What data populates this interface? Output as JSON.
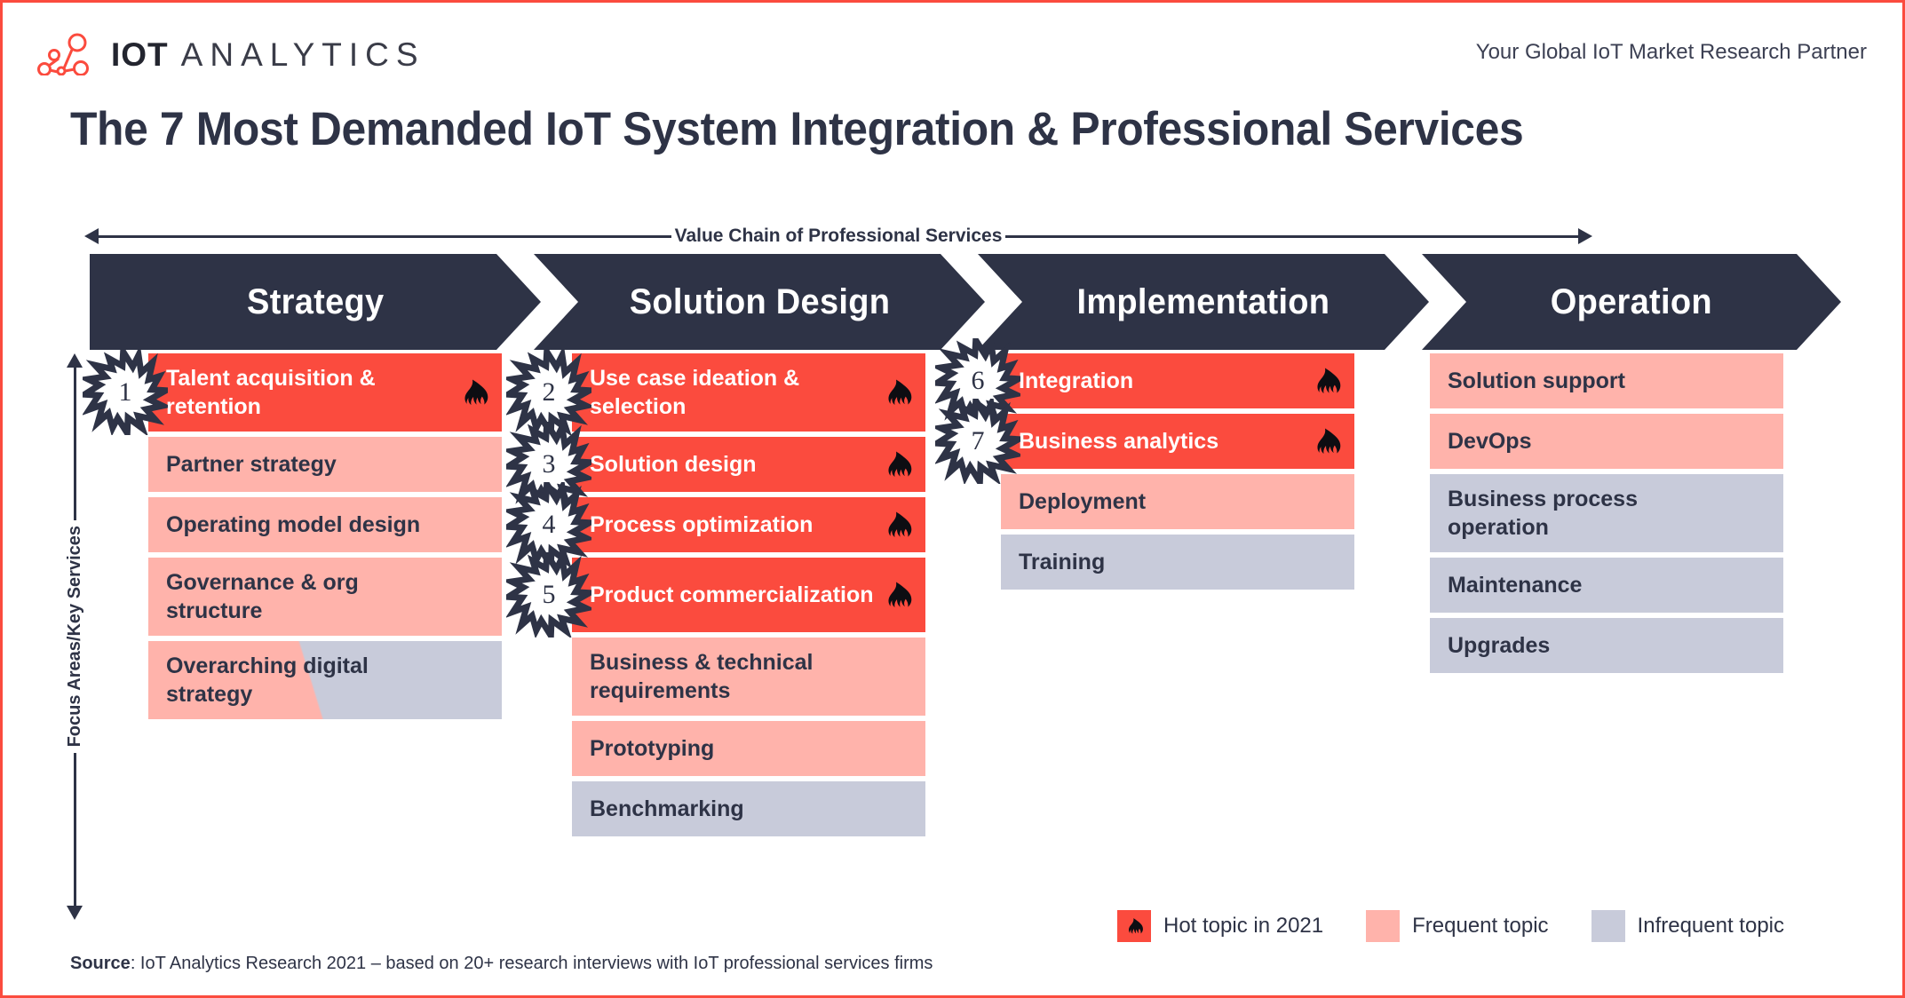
{
  "brand": {
    "logo_icon": "network-nodes-icon",
    "name_primary": "IOT",
    "name_secondary": "ANALYTICS",
    "accent_color": "#fb4b3e",
    "dark_color": "#2e3346"
  },
  "header": {
    "tagline": "Your Global IoT Market Research Partner",
    "title": "The 7 Most Demanded IoT System Integration & Professional Services"
  },
  "axes": {
    "horizontal_label": "Value Chain of Professional Services",
    "vertical_label": "Focus Areas/Key Services"
  },
  "stages": [
    {
      "label": "Strategy"
    },
    {
      "label": "Solution Design"
    },
    {
      "label": "Implementation"
    },
    {
      "label": "Operation"
    }
  ],
  "columns": [
    {
      "stage": "Strategy",
      "items": [
        {
          "label": "Talent acquisition & retention",
          "type": "hot",
          "rank": "1",
          "lines": 2
        },
        {
          "label": "Partner strategy",
          "type": "frequent",
          "rank": null,
          "lines": 1
        },
        {
          "label": "Operating model design",
          "type": "frequent",
          "rank": null,
          "lines": 1
        },
        {
          "label": "Governance & org structure",
          "type": "frequent",
          "rank": null,
          "lines": 2
        },
        {
          "label": "Overarching digital strategy",
          "type": "split",
          "rank": null,
          "lines": 2
        }
      ]
    },
    {
      "stage": "Solution Design",
      "items": [
        {
          "label": "Use case ideation & selection",
          "type": "hot",
          "rank": "2",
          "lines": 2
        },
        {
          "label": "Solution design",
          "type": "hot",
          "rank": "3",
          "lines": 1
        },
        {
          "label": "Process optimization",
          "type": "hot",
          "rank": "4",
          "lines": 1
        },
        {
          "label": "Product commercialization",
          "type": "hot",
          "rank": "5",
          "lines": 2
        },
        {
          "label": "Business & technical requirements",
          "type": "frequent",
          "rank": null,
          "lines": 2
        },
        {
          "label": "Prototyping",
          "type": "frequent",
          "rank": null,
          "lines": 1
        },
        {
          "label": "Benchmarking",
          "type": "infreq",
          "rank": null,
          "lines": 1
        }
      ]
    },
    {
      "stage": "Implementation",
      "items": [
        {
          "label": "Integration",
          "type": "hot",
          "rank": "6",
          "lines": 1
        },
        {
          "label": "Business analytics",
          "type": "hot",
          "rank": "7",
          "lines": 1
        },
        {
          "label": "Deployment",
          "type": "frequent",
          "rank": null,
          "lines": 1
        },
        {
          "label": "Training",
          "type": "infreq",
          "rank": null,
          "lines": 1
        }
      ]
    },
    {
      "stage": "Operation",
      "items": [
        {
          "label": "Solution support",
          "type": "frequent",
          "rank": null,
          "lines": 1
        },
        {
          "label": "DevOps",
          "type": "frequent",
          "rank": null,
          "lines": 1
        },
        {
          "label": "Business process operation",
          "type": "infreq",
          "rank": null,
          "lines": 2
        },
        {
          "label": "Maintenance",
          "type": "infreq",
          "rank": null,
          "lines": 1
        },
        {
          "label": "Upgrades",
          "type": "infreq",
          "rank": null,
          "lines": 1
        }
      ]
    }
  ],
  "legend": [
    {
      "label": "Hot topic in 2021",
      "type": "hot",
      "color": "#fb4b3e",
      "icon": "flame-icon"
    },
    {
      "label": "Frequent topic",
      "type": "frequent",
      "color": "#ffb3ab",
      "icon": null
    },
    {
      "label": "Infrequent topic",
      "type": "infreq",
      "color": "#c8cbda",
      "icon": null
    }
  ],
  "source": {
    "prefix": "Source",
    "text": ": IoT Analytics Research 2021 – based on 20+ research interviews with IoT professional services firms"
  }
}
